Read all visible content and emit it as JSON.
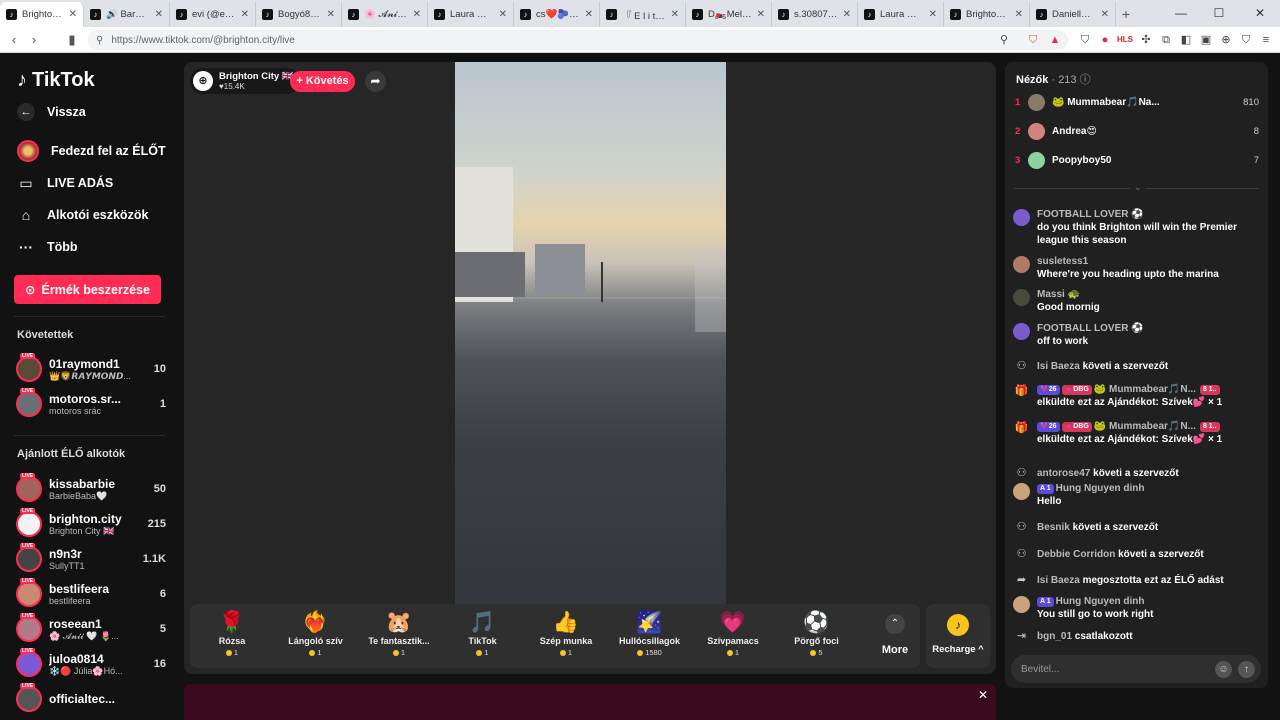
{
  "browser": {
    "tabs": [
      {
        "title": "Brighton C",
        "active": true
      },
      {
        "title": "🔊 BarbieBaba"
      },
      {
        "title": "evi (@evi0013"
      },
      {
        "title": "Bogyó87🥒🥒"
      },
      {
        "title": "🌸 𝓐𝓷𝓲𝓲 🤍 🌷"
      },
      {
        "title": "Laura 🗺🚂🚜"
      },
      {
        "title": "cs❤️🫐Dareidi"
      },
      {
        "title": "『 E l i t e C"
      },
      {
        "title": "D🏍️Melcsi"
      },
      {
        "title": "s.30807 (@s.3"
      },
      {
        "title": "Laura 🗺🚂🚜"
      },
      {
        "title": "Brighton City"
      },
      {
        "title": "Daniella🌋D"
      }
    ],
    "new_tab": "+",
    "minimize": "—",
    "maximize": "☐",
    "close": "✕",
    "url": "https://www.tiktok.com/@brighton.city/live"
  },
  "sidebar": {
    "logo": "TikTok",
    "back": "Vissza",
    "nav": [
      {
        "label": "Fedezd fel az ÉLŐT",
        "icon": "explore-avatar"
      },
      {
        "label": "LIVE ADÁS",
        "icon": "camera-icon"
      },
      {
        "label": "Alkotói eszközök",
        "icon": "home-icon"
      },
      {
        "label": "Több",
        "icon": "more-icon"
      }
    ],
    "coin_button": "Érmék beszerzése",
    "following_header": "Követettek",
    "following": [
      {
        "user": "01raymond1",
        "sub": "👑🦁𝙍𝘼𝙔𝙈𝙊𝙉𝘿...",
        "count": "10",
        "color": "#5b4a3a"
      },
      {
        "user": "motoros.sr...",
        "sub": "motoros srác",
        "count": "1",
        "color": "#6a6e75"
      }
    ],
    "recommended_header": "Ajánlott ÉLŐ alkotók",
    "recommended": [
      {
        "user": "kissabarbie",
        "sub": "BarbieBaba🤍",
        "count": "50",
        "color": "#a0655a"
      },
      {
        "user": "brighton.city",
        "sub": "Brighton City 🇬🇧",
        "count": "215",
        "color": "#f2f2f2"
      },
      {
        "user": "n9n3r",
        "sub": "SullyTT1",
        "count": "1.1K",
        "color": "#444"
      },
      {
        "user": "bestlifeera",
        "sub": "bestlifeera",
        "count": "6",
        "color": "#c98a72"
      },
      {
        "user": "roseean1",
        "sub": "🌸 𝓐𝓷𝓲𝓲 🤍 🌷...",
        "count": "5",
        "color": "#b07a88"
      },
      {
        "user": "juloa0814",
        "sub": "❄️🔴 Júlia🌸Hó...",
        "count": "16",
        "color": "#7a5ad8"
      },
      {
        "user": "officialtec...",
        "sub": "",
        "count": "",
        "color": "#555"
      }
    ]
  },
  "stream": {
    "host_name": "Brighton City 🇬🇧",
    "host_likes": "♥15.4K",
    "follow_label": "+ Követés",
    "share_icon": "share-icon"
  },
  "gifts": [
    {
      "name": "Rózsa",
      "price": "1",
      "icon": "🌹"
    },
    {
      "name": "Lángoló szív",
      "price": "1",
      "icon": "❤️‍🔥"
    },
    {
      "name": "Te fantasztik...",
      "price": "1",
      "icon": "🐹"
    },
    {
      "name": "TikTok",
      "price": "1",
      "icon": "🎵"
    },
    {
      "name": "Szép munka",
      "price": "1",
      "icon": "👍"
    },
    {
      "name": "Hullócsillagok",
      "price": "1580",
      "icon": "🌠"
    },
    {
      "name": "Szívpamacs",
      "price": "1",
      "icon": "💗"
    },
    {
      "name": "Pörgő foci",
      "price": "5",
      "icon": "⚽"
    }
  ],
  "more_label": "More",
  "recharge_label": "Recharge ^",
  "chat": {
    "viewers_label": "Nézők",
    "viewers_count": "· 213",
    "top_viewers": [
      {
        "rank": "1",
        "name": "🐸 Mummabear🎵Na...",
        "score": "810",
        "color": "#8a7a6a"
      },
      {
        "rank": "2",
        "name": "Andrea😍",
        "score": "8",
        "color": "#d2847a"
      },
      {
        "rank": "3",
        "name": "Poopyboy50",
        "score": "7",
        "color": "#8fd1a0"
      }
    ],
    "messages": [
      {
        "type": "text",
        "user": "FOOTBALL LOVER ⚽",
        "text": "do you think Brighton will win the Premier league this season",
        "color": "#7b5cd0"
      },
      {
        "type": "text",
        "user": "susletess1",
        "text": "Where're you heading upto the marina",
        "color": "#b07a66"
      },
      {
        "type": "text",
        "user": "Massi 🐢",
        "text": "Good mornig",
        "color": "#4a4a3a"
      },
      {
        "type": "text",
        "user": "FOOTBALL LOVER ⚽",
        "text": "off to work",
        "color": "#7b5cd0"
      },
      {
        "type": "event",
        "user": "Isi Baeza",
        "text": "követi a szervezőt",
        "icon": "follow-icon"
      },
      {
        "type": "gift",
        "badges": [
          "💜26",
          "💗DBG"
        ],
        "user": "🐸 Mummabear🎵N...",
        "badge2": "8 1..",
        "text": "elküldte ezt az Ajándékot: Szívek💕 × 1"
      },
      {
        "type": "gift",
        "badges": [
          "💜26",
          "💗DBG"
        ],
        "user": "🐸 Mummabear🎵N...",
        "badge2": "8 1..",
        "text": "elküldte ezt az Ajándékot: Szívek💕 × 1"
      },
      {
        "type": "event",
        "user": "antorose47",
        "text": "követi a szervezőt",
        "icon": "follow-icon"
      },
      {
        "type": "text",
        "user": "Hung Nguyen dinh",
        "badge": "A 1",
        "text": "Hello",
        "color": "#c9a47a"
      },
      {
        "type": "event",
        "user": "Besnik",
        "text": "követi a szervezőt",
        "icon": "follow-icon"
      },
      {
        "type": "event",
        "user": "Debbie Corridon",
        "text": "követi a szervezőt",
        "icon": "follow-icon"
      },
      {
        "type": "event",
        "user": "Isi Baeza",
        "text": "megosztotta ezt az ÉLŐ adást",
        "icon": "share-icon"
      },
      {
        "type": "text",
        "user": "Hung Nguyen dinh",
        "badge": "A 1",
        "text": "You still go to work right",
        "color": "#c9a47a"
      },
      {
        "type": "event",
        "user": "bgn_01",
        "text": "csatlakozott",
        "icon": "join-icon"
      }
    ],
    "input_placeholder": "Bevitel..."
  },
  "colors": {
    "accent": "#fe2c55",
    "coin": "#f7c31c"
  }
}
